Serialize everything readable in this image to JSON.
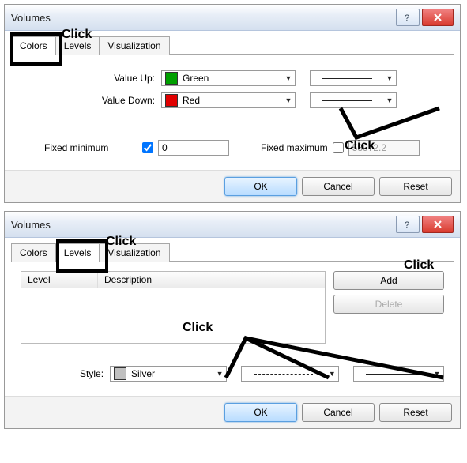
{
  "d1": {
    "title": "Volumes",
    "tabs": {
      "colors": "Colors",
      "levels": "Levels",
      "viz": "Visualization"
    },
    "valueUpLabel": "Value Up:",
    "valueUpColor": "Green",
    "valueUpHex": "#00a000",
    "valueDownLabel": "Value Down:",
    "valueDownColor": "Red",
    "valueDownHex": "#e00000",
    "fixedMinLabel": "Fixed minimum",
    "fixedMinValue": "0",
    "fixedMaxLabel": "Fixed maximum",
    "fixedMaxValue": "58972.2",
    "ok": "OK",
    "cancel": "Cancel",
    "reset": "Reset"
  },
  "d2": {
    "title": "Volumes",
    "tabs": {
      "colors": "Colors",
      "levels": "Levels",
      "viz": "Visualization"
    },
    "colLevel": "Level",
    "colDesc": "Description",
    "add": "Add",
    "delete": "Delete",
    "styleLabel": "Style:",
    "styleColor": "Silver",
    "styleHex": "#c0c0c0",
    "ok": "OK",
    "cancel": "Cancel",
    "reset": "Reset"
  },
  "ann": {
    "click": "Click"
  }
}
